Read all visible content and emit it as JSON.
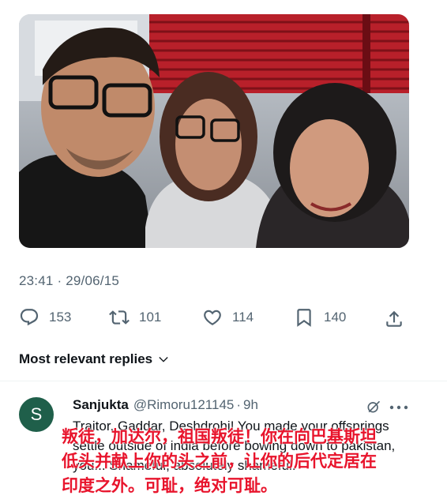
{
  "tweet": {
    "timestamp": "23:41 · 29/06/15",
    "stats": {
      "replies": "153",
      "retweets": "101",
      "likes": "114",
      "bookmarks": "140"
    }
  },
  "replies_header": {
    "label": "Most relevant replies"
  },
  "reply": {
    "avatar_letter": "S",
    "name": "Sanjukta",
    "handle": "@Rimoru121145",
    "separator": "·",
    "time": "9h",
    "text": "Traitor, Gaddar, Deshdrohi! You made your offsprings settle outside of india before bowing down to pakistan, you... Shameful, absolutely shameful.",
    "translation_overlay": "叛徒，加达尔，祖国叛徒！你在向巴基斯坦\n低头并献上你的头之前，让你的后代定居在\n印度之外。可耻，绝对可耻。"
  },
  "icons": {
    "reply": "reply-icon",
    "retweet": "retweet-icon",
    "like": "heart-icon",
    "bookmark": "bookmark-icon",
    "share": "share-icon",
    "grok": "grok-icon",
    "more": "more-icon",
    "chevron": "chevron-down-icon"
  },
  "colors": {
    "secondary_text": "#536471",
    "primary_text": "#0f1419",
    "avatar_bg": "#1f5f4a",
    "overlay_text": "#e8142c"
  }
}
